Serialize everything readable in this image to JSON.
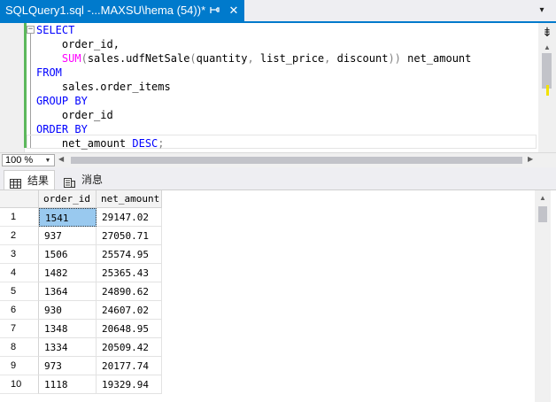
{
  "tab": {
    "title": "SQLQuery1.sql -...MAXSU\\hema (54))*",
    "close_glyph": "✕",
    "dropdown_glyph": "▾"
  },
  "editor": {
    "lines": [
      [
        {
          "t": "SELECT",
          "c": "kw"
        }
      ],
      [
        {
          "t": "    order_id,",
          "c": ""
        }
      ],
      [
        {
          "t": "    ",
          "c": ""
        },
        {
          "t": "SUM",
          "c": "fn"
        },
        {
          "t": "(",
          "c": "gr"
        },
        {
          "t": "sales.udfNetSale",
          "c": ""
        },
        {
          "t": "(",
          "c": "gr"
        },
        {
          "t": "quantity",
          "c": ""
        },
        {
          "t": ",",
          "c": "gr"
        },
        {
          "t": " list_price",
          "c": ""
        },
        {
          "t": ",",
          "c": "gr"
        },
        {
          "t": " discount",
          "c": ""
        },
        {
          "t": "))",
          "c": "gr"
        },
        {
          "t": " net_amount",
          "c": ""
        }
      ],
      [
        {
          "t": "FROM",
          "c": "kw"
        }
      ],
      [
        {
          "t": "    sales.order_items",
          "c": ""
        }
      ],
      [
        {
          "t": "GROUP BY",
          "c": "kw"
        }
      ],
      [
        {
          "t": "    order_id",
          "c": ""
        }
      ],
      [
        {
          "t": "ORDER BY",
          "c": "kw"
        }
      ],
      [
        {
          "t": "    net_amount ",
          "c": ""
        },
        {
          "t": "DESC",
          "c": "kw"
        },
        {
          "t": ";",
          "c": "gr"
        }
      ]
    ]
  },
  "zoom": {
    "value": "100 %"
  },
  "results_tabs": {
    "results": "结果",
    "messages": "消息"
  },
  "grid": {
    "columns": [
      "order_id",
      "net_amount"
    ],
    "rows": [
      [
        "1",
        "1541",
        "29147.02"
      ],
      [
        "2",
        "937",
        "27050.71"
      ],
      [
        "3",
        "1506",
        "25574.95"
      ],
      [
        "4",
        "1482",
        "25365.43"
      ],
      [
        "5",
        "1364",
        "24890.62"
      ],
      [
        "6",
        "930",
        "24607.02"
      ],
      [
        "7",
        "1348",
        "20648.95"
      ],
      [
        "8",
        "1334",
        "20509.42"
      ],
      [
        "9",
        "973",
        "20177.74"
      ],
      [
        "10",
        "1118",
        "19329.94"
      ]
    ]
  }
}
